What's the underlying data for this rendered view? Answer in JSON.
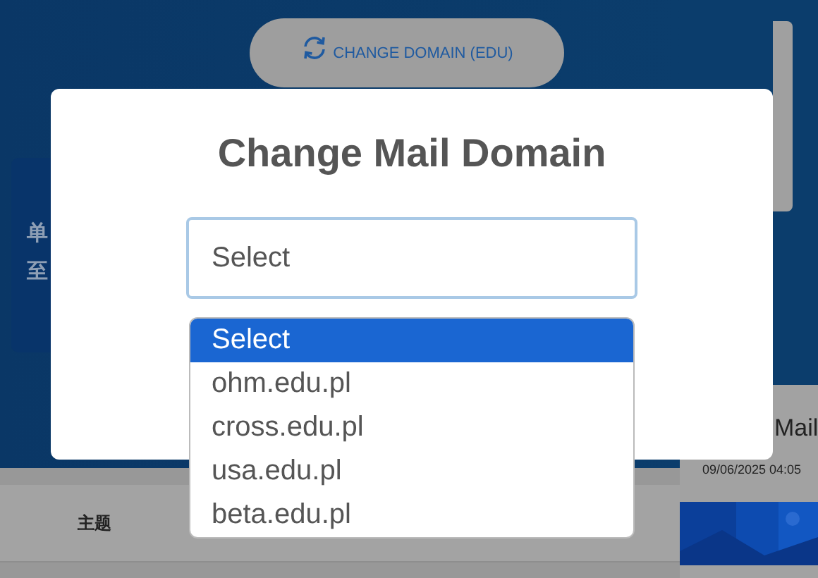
{
  "header_button": {
    "label": "CHANGE DOMAIN (EDU)"
  },
  "background": {
    "left_card": {
      "lines": [
        "单",
        "至"
      ]
    },
    "table": {
      "columns": [
        "主题"
      ]
    },
    "side_panel": {
      "title": "Mail",
      "timestamp": "09/06/2025 04:05"
    }
  },
  "dialog": {
    "title": "Change Mail Domain",
    "select": {
      "value": "Select",
      "expanded": true
    },
    "options": [
      {
        "label": "Select",
        "selected": true
      },
      {
        "label": "ohm.edu.pl",
        "selected": false
      },
      {
        "label": "cross.edu.pl",
        "selected": false
      },
      {
        "label": "usa.edu.pl",
        "selected": false
      },
      {
        "label": "beta.edu.pl",
        "selected": false
      }
    ]
  }
}
